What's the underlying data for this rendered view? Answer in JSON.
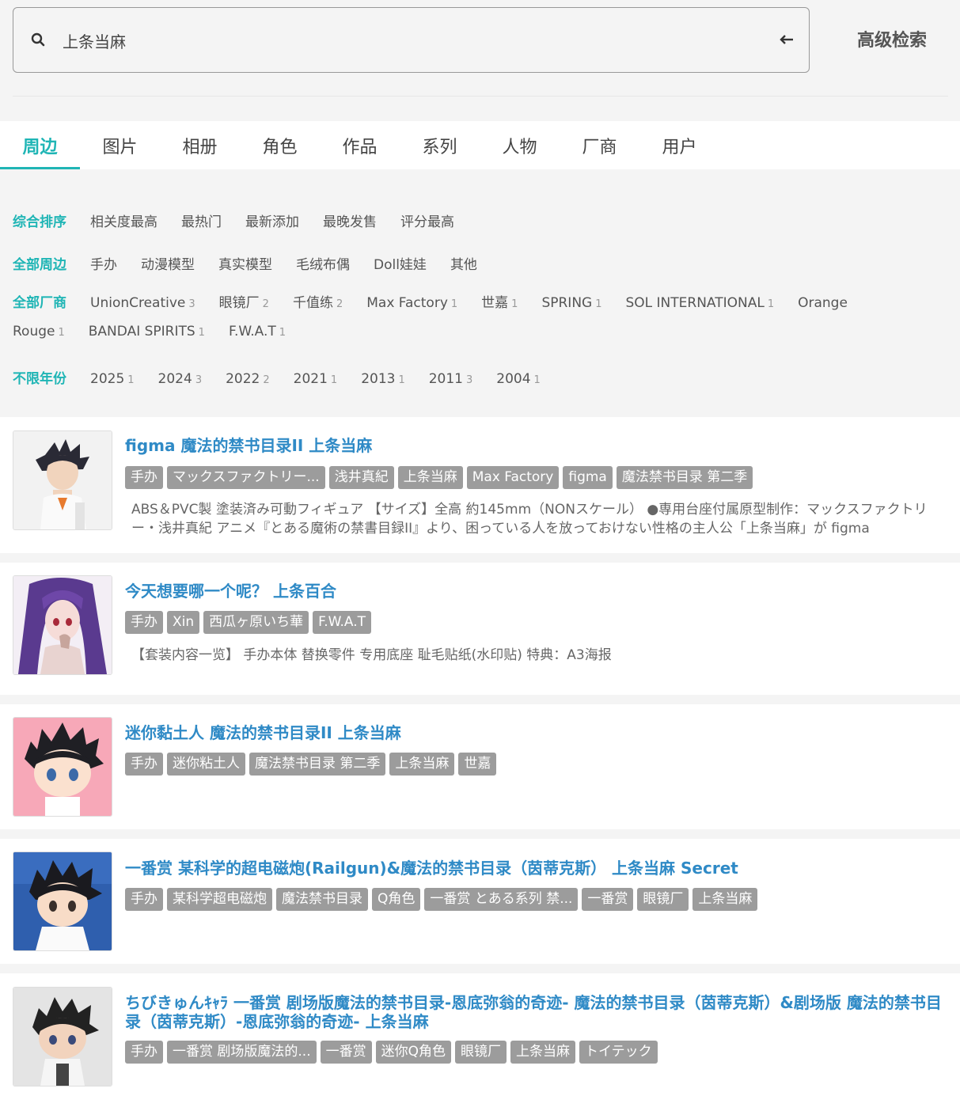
{
  "search": {
    "value": "上条当麻",
    "advanced_label": "高级检索"
  },
  "tabs": [
    {
      "label": "周边",
      "active": true
    },
    {
      "label": "图片"
    },
    {
      "label": "相册"
    },
    {
      "label": "角色"
    },
    {
      "label": "作品"
    },
    {
      "label": "系列"
    },
    {
      "label": "人物"
    },
    {
      "label": "厂商"
    },
    {
      "label": "用户"
    }
  ],
  "filters": {
    "sort": {
      "label": "综合排序",
      "items": [
        "相关度最高",
        "最热门",
        "最新添加",
        "最晚发售",
        "评分最高"
      ]
    },
    "category": {
      "label": "全部周边",
      "items": [
        "手办",
        "动漫模型",
        "真实模型",
        "毛绒布偶",
        "Doll娃娃",
        "其他"
      ]
    },
    "maker": {
      "label": "全部厂商",
      "items": [
        {
          "name": "UnionCreative",
          "count": "3"
        },
        {
          "name": "眼镜厂",
          "count": "2"
        },
        {
          "name": "千值练",
          "count": "2"
        },
        {
          "name": "Max Factory",
          "count": "1"
        },
        {
          "name": "世嘉",
          "count": "1"
        },
        {
          "name": "SPRING",
          "count": "1"
        },
        {
          "name": "SOL INTERNATIONAL",
          "count": "1"
        },
        {
          "name": "Orange Rouge",
          "count": "1"
        },
        {
          "name": "BANDAI SPIRITS",
          "count": "1"
        },
        {
          "name": "F.W.A.T",
          "count": "1"
        }
      ]
    },
    "year": {
      "label": "不限年份",
      "items": [
        {
          "name": "2025",
          "count": "1"
        },
        {
          "name": "2024",
          "count": "3"
        },
        {
          "name": "2022",
          "count": "2"
        },
        {
          "name": "2021",
          "count": "1"
        },
        {
          "name": "2013",
          "count": "1"
        },
        {
          "name": "2011",
          "count": "3"
        },
        {
          "name": "2004",
          "count": "1"
        }
      ]
    }
  },
  "results": [
    {
      "title": "figma 魔法的禁书目录II 上条当麻",
      "tags": [
        "手办",
        "マックスファクトリー...",
        "浅井真紀",
        "上条当麻",
        "Max Factory",
        "figma",
        "魔法禁书目录 第二季"
      ],
      "desc": "ABS＆PVC製 塗装済み可動フィギュア 【サイズ】全高 約145mm（NONスケール） ●専用台座付属原型制作：マックスファクトリー・浅井真紀 アニメ『とある魔術の禁書目録II』より、困っている人を放っておけない性格の主人公「上条当麻」が figma",
      "thumb": "figma-figure"
    },
    {
      "title": "今天想要哪一个呢？ 上条百合",
      "tags": [
        "手办",
        "Xin",
        "西瓜ヶ原いち華",
        "F.W.A.T"
      ],
      "desc": "【套装内容一览】 手办本体 替换零件 专用底座 耻毛贴纸(水印贴) 特典：A3海报",
      "thumb": "purple-hair-figure"
    },
    {
      "title": "迷你黏土人 魔法的禁书目录II 上条当麻",
      "tags": [
        "手办",
        "迷你粘土人",
        "魔法禁书目录 第二季",
        "上条当麻",
        "世嘉"
      ],
      "desc": "",
      "thumb": "mini-nendoroid"
    },
    {
      "title": "一番赏 某科学的超电磁炮(Railgun)&魔法的禁书目录（茵蒂克斯） 上条当麻 Secret",
      "tags": [
        "手办",
        "某科学超电磁炮",
        "魔法禁书目录",
        "Q角色",
        "一番赏 とある系列 禁...",
        "一番赏",
        "眼镜厂",
        "上条当麻"
      ],
      "desc": "",
      "thumb": "kuji-figure"
    },
    {
      "title": "ちびきゅんｷｬﾗ 一番赏 剧场版魔法的禁书目录-恩底弥翁的奇迹- 魔法的禁书目录（茵蒂克斯）&剧场版 魔法的禁书目录（茵蒂克斯）-恩底弥翁的奇迹- 上条当麻",
      "tags": [
        "手办",
        "一番赏 剧场版魔法的...",
        "一番赏",
        "迷你Q角色",
        "眼镜厂",
        "上条当麻",
        "トイテック"
      ],
      "desc": "",
      "thumb": "chibi-figure"
    }
  ]
}
